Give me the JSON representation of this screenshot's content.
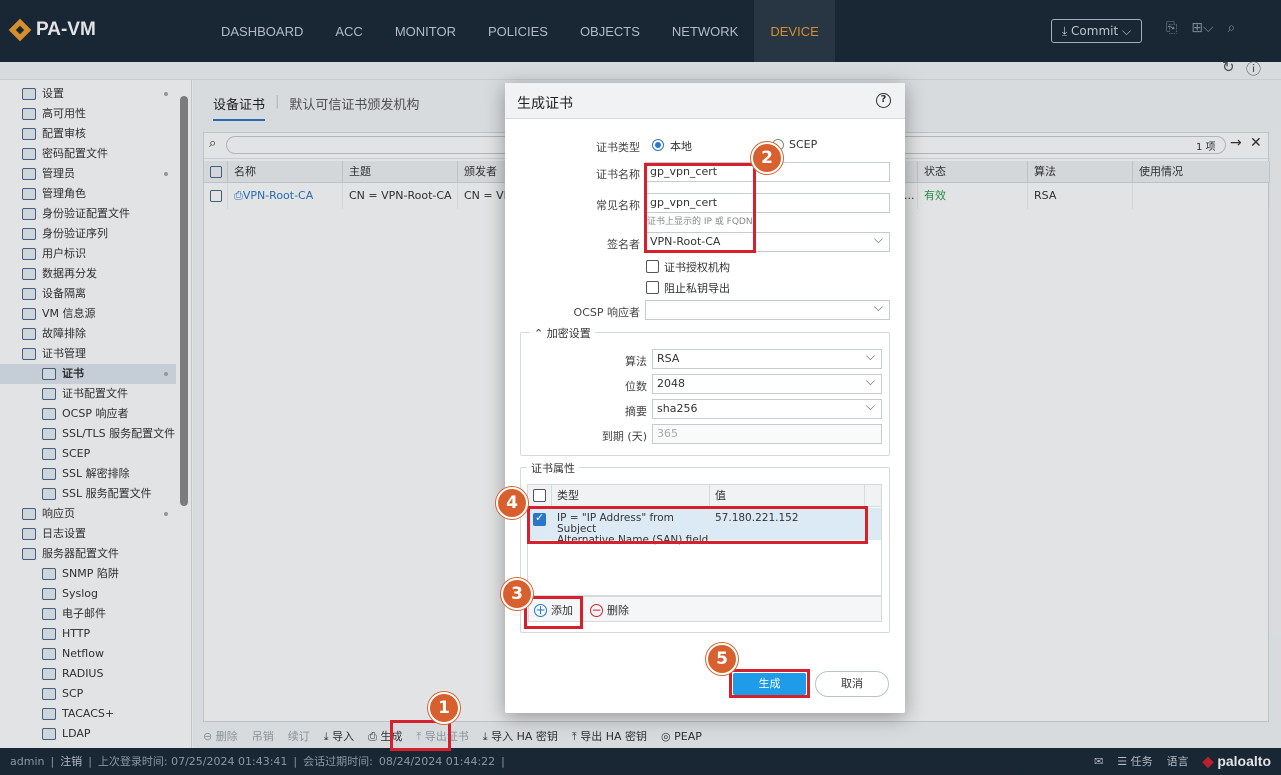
{
  "app": {
    "logo": "PA-VM"
  },
  "nav": [
    "DASHBOARD",
    "ACC",
    "MONITOR",
    "POLICIES",
    "OBJECTS",
    "NETWORK",
    "DEVICE"
  ],
  "nav_active": "DEVICE",
  "commit_label": "Commit",
  "sidebar": [
    {
      "label": "设置",
      "depth": 0
    },
    {
      "label": "高可用性",
      "depth": 0
    },
    {
      "label": "配置审核",
      "depth": 0
    },
    {
      "label": "密码配置文件",
      "depth": 0
    },
    {
      "label": "管理员",
      "depth": 0
    },
    {
      "label": "管理角色",
      "depth": 0
    },
    {
      "label": "身份验证配置文件",
      "depth": 0
    },
    {
      "label": "身份验证序列",
      "depth": 0
    },
    {
      "label": "用户标识",
      "depth": 0
    },
    {
      "label": "数据再分发",
      "depth": 0
    },
    {
      "label": "设备隔离",
      "depth": 0
    },
    {
      "label": "VM 信息源",
      "depth": 0
    },
    {
      "label": "故障排除",
      "depth": 0
    },
    {
      "label": "证书管理",
      "depth": 0
    },
    {
      "label": "证书",
      "depth": 1,
      "selected": true
    },
    {
      "label": "证书配置文件",
      "depth": 1
    },
    {
      "label": "OCSP 响应者",
      "depth": 1
    },
    {
      "label": "SSL/TLS 服务配置文件",
      "depth": 1
    },
    {
      "label": "SCEP",
      "depth": 1
    },
    {
      "label": "SSL 解密排除",
      "depth": 1
    },
    {
      "label": "SSL 服务配置文件",
      "depth": 1
    },
    {
      "label": "响应页",
      "depth": 0
    },
    {
      "label": "日志设置",
      "depth": 0
    },
    {
      "label": "服务器配置文件",
      "depth": 0
    },
    {
      "label": "SNMP 陷阱",
      "depth": 1
    },
    {
      "label": "Syslog",
      "depth": 1
    },
    {
      "label": "电子邮件",
      "depth": 1
    },
    {
      "label": "HTTP",
      "depth": 1
    },
    {
      "label": "Netflow",
      "depth": 1
    },
    {
      "label": "RADIUS",
      "depth": 1
    },
    {
      "label": "SCP",
      "depth": 1
    },
    {
      "label": "TACACS+",
      "depth": 1
    },
    {
      "label": "LDAP",
      "depth": 1
    }
  ],
  "tabs": {
    "active": "设备证书",
    "other": "默认可信证书颁发机构"
  },
  "grid": {
    "count": "1 项",
    "headers": [
      "名称",
      "主题",
      "颁发者",
      "状态",
      "算法",
      "使用情况"
    ],
    "row": {
      "name": "VPN-Root-CA",
      "subject": "CN = VPN-Root-CA",
      "issuer": "CN = VF",
      "dots": "...",
      "status": "有效",
      "algorithm": "RSA"
    }
  },
  "bottom_actions": [
    "删除",
    "吊销",
    "续订",
    "导入",
    "生成",
    "导出证书",
    "导入 HA 密钥",
    "导出 HA 密钥",
    "PEAP"
  ],
  "status_bar": {
    "user": "admin",
    "logout": "注销",
    "last_login": "上次登录时间: 07/25/2024 01:43:41",
    "session": "会话过期时间:",
    "session_time": "08/24/2024 01:44:22",
    "tasks": "任务",
    "language": "语言",
    "brand": "paloalto"
  },
  "dialog": {
    "title": "生成证书",
    "cert_type_label": "证书类型",
    "cert_type_local": "本地",
    "cert_type_scep": "SCEP",
    "cert_name_label": "证书名称",
    "cert_name": "gp_vpn_cert",
    "common_name_label": "常见名称",
    "common_name": "gp_vpn_cert",
    "common_name_hint": "证书上显示的 IP 或 FQDN",
    "signer_label": "签名者",
    "signer": "VPN-Root-CA",
    "ca_label": "证书授权机构",
    "block_export_label": "阻止私钥导出",
    "ocsp_label": "OCSP 响应者",
    "crypto_legend": "加密设置",
    "algorithm_label": "算法",
    "algorithm": "RSA",
    "bits_label": "位数",
    "bits": "2048",
    "digest_label": "摘要",
    "digest": "sha256",
    "expiry_label": "到期 (天)",
    "expiry": "365",
    "attr_legend": "证书属性",
    "attr_headers": [
      "类型",
      "值"
    ],
    "attr_type": "IP = \"IP Address\" from Subject Alternative Name (SAN) field",
    "attr_type_l1": "IP = \"IP Address\" from Subject",
    "attr_type_l2": "Alternative Name (SAN) field",
    "attr_value": "57.180.221.152",
    "add_label": "添加",
    "delete_label": "删除",
    "generate_label": "生成",
    "cancel_label": "取消"
  },
  "badges": [
    "1",
    "2",
    "3",
    "4",
    "5"
  ],
  "colors": {
    "nav_bg": "#1b2836",
    "accent": "#f0a030",
    "primary": "#1e9be9",
    "highlight": "#d7202e",
    "badge": "#d7602e"
  }
}
